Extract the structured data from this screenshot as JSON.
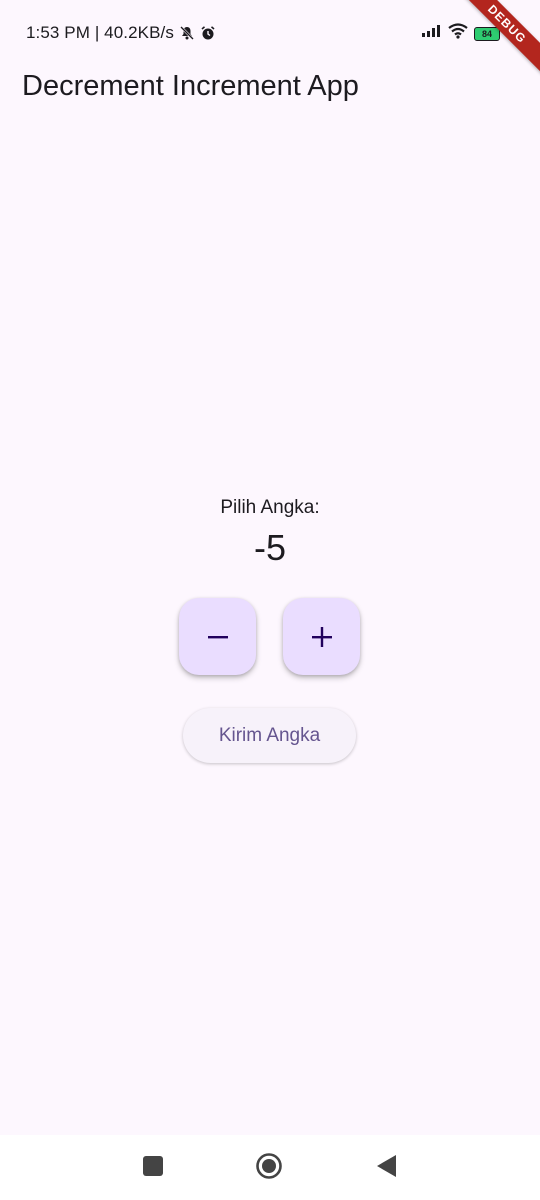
{
  "status_bar": {
    "time_network": "1:53 PM | 40.2KB/s",
    "battery_level": "84"
  },
  "debug_banner": "DEBUG",
  "app_bar": {
    "title": "Decrement Increment App"
  },
  "counter": {
    "label": "Pilih Angka:",
    "value": "-5"
  },
  "buttons": {
    "decrement_icon": "minus-icon",
    "increment_icon": "plus-icon",
    "send_label": "Kirim Angka"
  },
  "nav_bar": {
    "recents_icon": "square-icon",
    "home_icon": "circle-icon",
    "back_icon": "triangle-back-icon"
  },
  "colors": {
    "background": "#fdf7fe",
    "fab_background": "#eaddff",
    "send_text": "#65558f",
    "debug_ribbon": "#b3261e"
  }
}
